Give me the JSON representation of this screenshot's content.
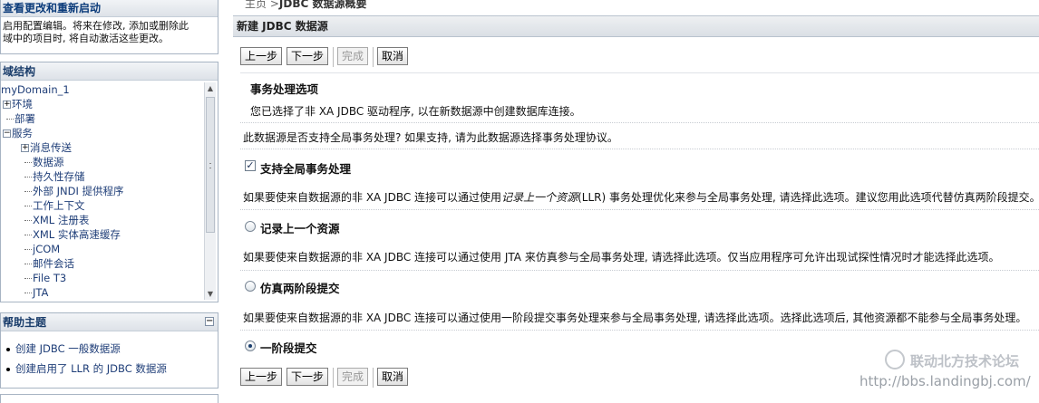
{
  "left": {
    "changes": {
      "title": "查看更改和重新启动",
      "text_line1": "启用配置编辑。将来在修改, 添加或删除此",
      "text_line2": "域中的项目时, 将自动激活这些更改。"
    },
    "domain_structure": {
      "title": "域结构",
      "tree": [
        {
          "label": "myDomain_1"
        },
        {
          "label": "环境",
          "prefix": "⊞"
        },
        {
          "label": "部署"
        },
        {
          "label": "服务",
          "prefix": "⊟"
        },
        {
          "label": "消息传送",
          "prefix": "⊞"
        },
        {
          "label": "数据源"
        },
        {
          "label": "持久性存储"
        },
        {
          "label": "外部 JNDI 提供程序"
        },
        {
          "label": "工作上下文"
        },
        {
          "label": "XML 注册表"
        },
        {
          "label": "XML 实体高速缓存"
        },
        {
          "label": "jCOM"
        },
        {
          "label": "邮件会话"
        },
        {
          "label": "File T3"
        },
        {
          "label": "JTA"
        }
      ]
    },
    "help": {
      "title": "帮助主题",
      "items": [
        "创建 JDBC 一般数据源",
        "创建启用了 LLR 的 JDBC 数据源"
      ]
    }
  },
  "breadcrumb": {
    "home": "主页",
    "sep": " >",
    "current": "JDBC 数据源概要"
  },
  "main": {
    "title": "新建 JDBC 数据源",
    "buttons": {
      "back": "上一步",
      "next": "下一步",
      "finish": "完成",
      "cancel": "取消"
    },
    "section_title": "事务处理选项",
    "section_desc": "您已选择了非 XA JDBC 驱动程序, 以在新数据源中创建数据库连接。",
    "question": "此数据源是否支持全局事务处理? 如果支持, 请为此数据源选择事务处理协议。",
    "support_global": {
      "label": "支持全局事务处理",
      "checked": true
    },
    "llr_desc_pre": "如果要使来自数据源的非 XA JDBC 连接可以通过使用",
    "llr_desc_italic": "记录上一个资源",
    "llr_desc_post": "(LLR) 事务处理优化来参与全局事务处理, 请选择此选项。建议您用此选项代替仿真两阶段提交。",
    "options": [
      {
        "label": "记录上一个资源",
        "checked": false
      },
      {
        "label": "仿真两阶段提交",
        "checked": false
      },
      {
        "label": "一阶段提交",
        "checked": true
      }
    ],
    "jta_desc": "如果要使来自数据源的非 XA JDBC 连接可以通过使用 JTA 来仿真参与全局事务处理, 请选择此选项。仅当应用程序可允许出现试探性情况时才能选择此选项。",
    "one_phase_desc": "如果要使来自数据源的非 XA JDBC 连接可以通过使用一阶段提交事务处理来参与全局事务处理, 请选择此选项。选择此选项后, 其他资源都不能参与全局事务处理。"
  },
  "watermark": {
    "name": "联动北方技术论坛",
    "url": "http://bbs.landingbj.com/"
  }
}
